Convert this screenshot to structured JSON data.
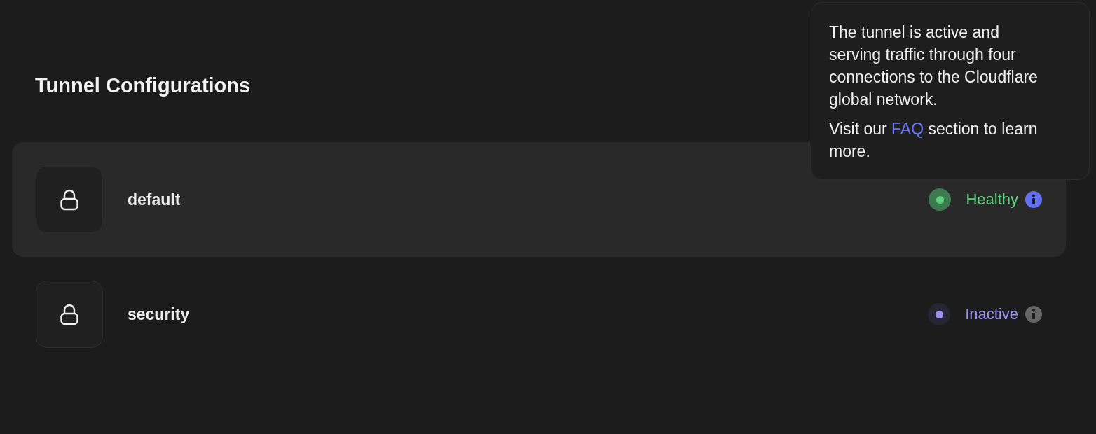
{
  "title": "Tunnel Configurations",
  "tunnels": [
    {
      "name": "default",
      "selected": true,
      "status": {
        "kind": "healthy",
        "label": "Healthy"
      }
    },
    {
      "name": "security",
      "selected": false,
      "status": {
        "kind": "inactive",
        "label": "Inactive"
      }
    }
  ],
  "tooltip": {
    "paragraph": "The tunnel is active and serving traffic through four connections to the Cloudflare global network.",
    "link_before": "Visit our ",
    "link": "FAQ",
    "link_after": " section to learn more."
  }
}
